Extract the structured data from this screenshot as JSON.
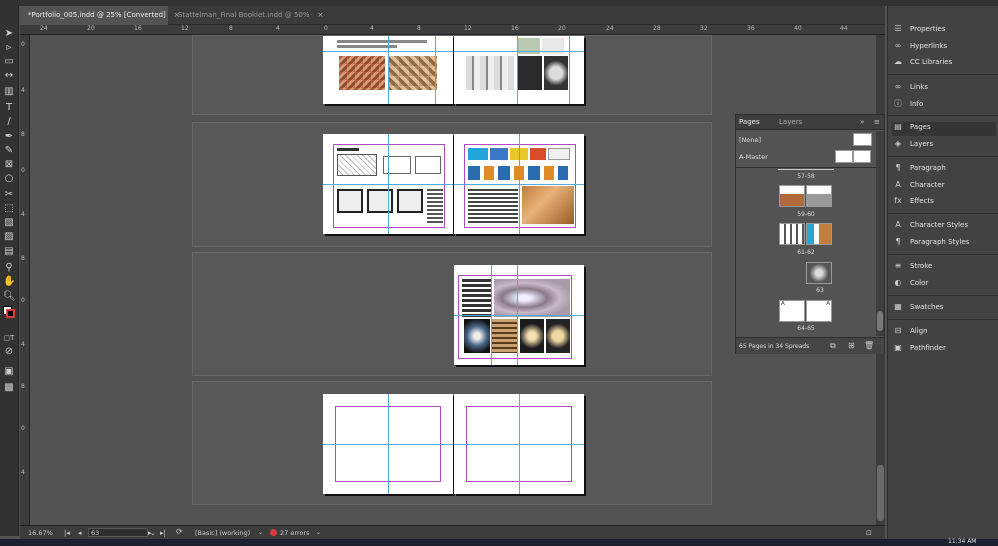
{
  "document_tabs": [
    {
      "label": "*Portfolio_005.indd @ 25% [Converted]",
      "close": "×"
    },
    {
      "label": "Stattelman_Final Booklet.indd @ 50%",
      "close": "×"
    }
  ],
  "hruler_ticks": [
    "24",
    "20",
    "16",
    "12",
    "8",
    "4",
    "0",
    "4",
    "8",
    "12",
    "16",
    "20",
    "24",
    "28",
    "32",
    "36",
    "40",
    "44"
  ],
  "vruler_ticks": [
    "0",
    "4",
    "8",
    "0",
    "4",
    "8",
    "0",
    "4",
    "8",
    "0",
    "4"
  ],
  "pages_panel": {
    "tabs": [
      "Pages",
      "Layers"
    ],
    "menu_icon": "»",
    "none_label": "[None]",
    "master_label": "A-Master",
    "thumb_labels": [
      "57-58",
      "59-60",
      "61-62",
      "63",
      "64-65"
    ],
    "master_letter": "A",
    "footer": "65 Pages in 34 Spreads"
  },
  "right_panel": {
    "items": [
      "Properties",
      "Hyperlinks",
      "CC Libraries",
      "Links",
      "Info",
      "Pages",
      "Layers",
      "Paragraph",
      "Character",
      "Effects",
      "Character Styles",
      "Paragraph Styles",
      "Stroke",
      "Color",
      "Swatches",
      "Align",
      "Pathfinder"
    ],
    "icons": [
      "☰",
      "∞",
      "☁",
      "∞",
      "ⓘ",
      "▤",
      "◈",
      "¶",
      "A",
      "fx",
      "A",
      "¶",
      "≡",
      "◐",
      "▦",
      "⊟",
      "▣"
    ]
  },
  "status": {
    "zoom": "16.67%",
    "page_number": "63",
    "style": "[Basic] (working)",
    "errors": "27 errors",
    "clock": "11:34 AM"
  },
  "colors": {
    "accent": "#d93b3b",
    "guide": "#55aadd",
    "margin": "#b04cc2"
  }
}
